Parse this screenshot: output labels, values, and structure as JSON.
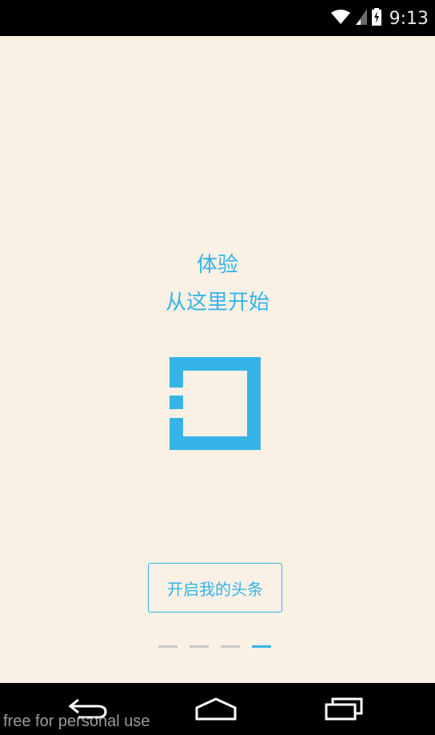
{
  "status_bar": {
    "time": "9:13",
    "icons": [
      "wifi-icon",
      "signal-icon",
      "battery-charging-icon"
    ]
  },
  "welcome": {
    "line1": "体验",
    "line2": "从这里开始"
  },
  "logo": {
    "icon": "toutiao-logo-icon",
    "color": "#35b4e8"
  },
  "cta_button": {
    "label": "开启我的头条"
  },
  "page_indicator": {
    "count": 4,
    "active_index": 3
  },
  "nav_bar": {
    "buttons": [
      "back-icon",
      "home-icon",
      "recent-apps-icon"
    ]
  },
  "watermark": {
    "text": "free for personal use"
  },
  "colors": {
    "background": "#faf1e4",
    "accent": "#35b4e8",
    "indicator_inactive": "#c9c9c9"
  }
}
